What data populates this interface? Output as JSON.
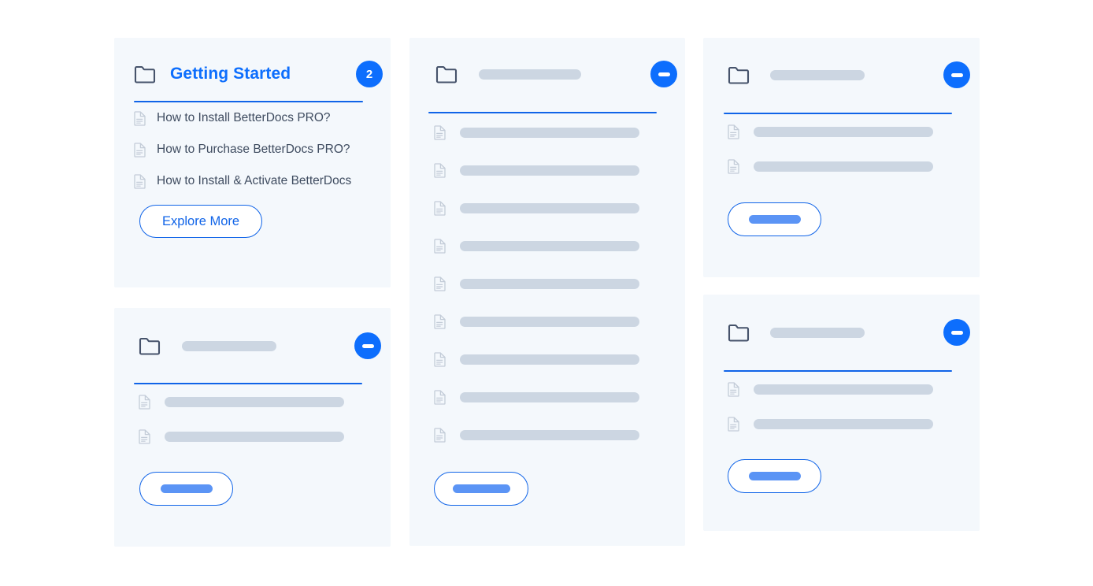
{
  "colors": {
    "card_bg": "#f4f8fc",
    "page_bg": "#ffffff",
    "accent_blue": "#0d6efd",
    "divider_blue": "#1064e8",
    "skeleton_gray": "#ccd6e2",
    "skeleton_blue": "#5b94f5",
    "text_slate": "#3f4c60",
    "icon_outline": "#46536b"
  },
  "cards": [
    {
      "id": "getting-started",
      "state": "loaded",
      "header": {
        "folder_icon": "folder-icon",
        "title": "Getting Started",
        "badge": {
          "type": "count-badge",
          "label": "2"
        }
      },
      "docs": [
        {
          "icon": "document-icon",
          "label": "How to Install BetterDocs PRO?"
        },
        {
          "icon": "document-icon",
          "label": "How to Purchase BetterDocs PRO?"
        },
        {
          "icon": "document-icon",
          "label": "How to Install & Activate BetterDocs"
        }
      ],
      "button": {
        "type": "text",
        "label": "Explore More"
      }
    },
    {
      "id": "placeholder-card-2",
      "state": "loading",
      "header": {
        "folder_icon": "folder-icon",
        "title": "",
        "badge": {
          "type": "collapse-badge",
          "label": ""
        }
      },
      "doc_count": 9,
      "button": {
        "type": "skeleton",
        "label": ""
      }
    },
    {
      "id": "placeholder-card-3",
      "state": "loading",
      "header": {
        "folder_icon": "folder-icon",
        "title": "",
        "badge": {
          "type": "collapse-badge",
          "label": ""
        }
      },
      "doc_count": 2,
      "button": {
        "type": "skeleton",
        "label": ""
      }
    },
    {
      "id": "placeholder-card-4",
      "state": "loading",
      "header": {
        "folder_icon": "folder-icon",
        "title": "",
        "badge": {
          "type": "collapse-badge",
          "label": ""
        }
      },
      "doc_count": 2,
      "button": {
        "type": "skeleton",
        "label": ""
      }
    },
    {
      "id": "placeholder-card-5",
      "state": "loading",
      "header": {
        "folder_icon": "folder-icon",
        "title": "",
        "badge": {
          "type": "collapse-badge",
          "label": ""
        }
      },
      "doc_count": 2,
      "button": {
        "type": "skeleton",
        "label": ""
      }
    }
  ]
}
